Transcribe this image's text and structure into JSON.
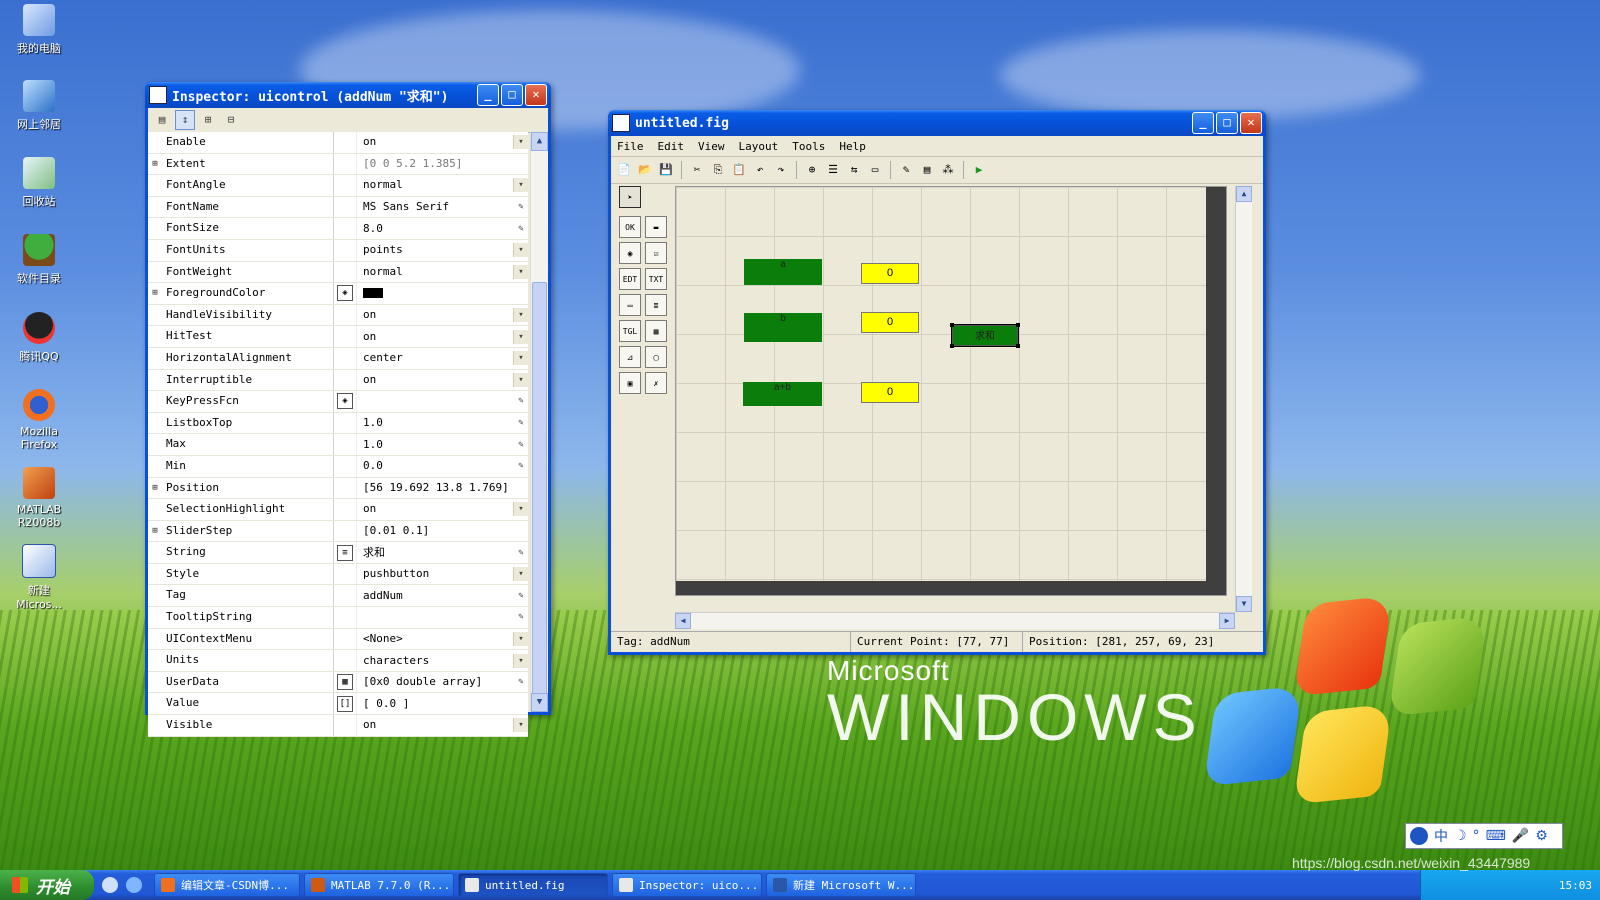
{
  "desktop_icons": [
    {
      "label": "我的电脑",
      "icon": "my-computer-icon"
    },
    {
      "label": "网上邻居",
      "icon": "network-icon"
    },
    {
      "label": "回收站",
      "icon": "recycle-bin-icon"
    },
    {
      "label": "软件目录",
      "icon": "tree-icon"
    },
    {
      "label": "腾讯QQ",
      "icon": "qq-penguin-icon"
    },
    {
      "label": "Mozilla Firefox",
      "icon": "firefox-icon"
    },
    {
      "label": "MATLAB R2008b",
      "icon": "matlab-icon"
    },
    {
      "label": "新建 Micros...",
      "icon": "word-doc-icon"
    }
  ],
  "inspector": {
    "title": "Inspector:  uicontrol (addNum \"求和\")",
    "properties": [
      {
        "name": "Enable",
        "value": "on",
        "expand": "",
        "ctl": "▾",
        "btn": ""
      },
      {
        "name": "Extent",
        "value": "[0 0 5.2 1.385]",
        "expand": "⊞",
        "ctl": "",
        "btn": ""
      },
      {
        "name": "FontAngle",
        "value": "normal",
        "expand": "",
        "ctl": "▾",
        "btn": ""
      },
      {
        "name": "FontName",
        "value": "MS Sans Serif",
        "expand": "",
        "ctl": "✎",
        "btn": ""
      },
      {
        "name": "FontSize",
        "value": "8.0",
        "expand": "",
        "ctl": "✎",
        "btn": ""
      },
      {
        "name": "FontUnits",
        "value": "points",
        "expand": "",
        "ctl": "▾",
        "btn": ""
      },
      {
        "name": "FontWeight",
        "value": "normal",
        "expand": "",
        "ctl": "▾",
        "btn": ""
      },
      {
        "name": "ForegroundColor",
        "value": "",
        "expand": "⊞",
        "ctl": "",
        "btn": "◈"
      },
      {
        "name": "HandleVisibility",
        "value": "on",
        "expand": "",
        "ctl": "▾",
        "btn": ""
      },
      {
        "name": "HitTest",
        "value": "on",
        "expand": "",
        "ctl": "▾",
        "btn": ""
      },
      {
        "name": "HorizontalAlignment",
        "value": "center",
        "expand": "",
        "ctl": "▾",
        "btn": ""
      },
      {
        "name": "Interruptible",
        "value": "on",
        "expand": "",
        "ctl": "▾",
        "btn": ""
      },
      {
        "name": "KeyPressFcn",
        "value": "",
        "expand": "",
        "ctl": "✎",
        "btn": "◈"
      },
      {
        "name": "ListboxTop",
        "value": "1.0",
        "expand": "",
        "ctl": "✎",
        "btn": ""
      },
      {
        "name": "Max",
        "value": "1.0",
        "expand": "",
        "ctl": "✎",
        "btn": ""
      },
      {
        "name": "Min",
        "value": "0.0",
        "expand": "",
        "ctl": "✎",
        "btn": ""
      },
      {
        "name": "Position",
        "value": "[56 19.692 13.8 1.769]",
        "expand": "⊞",
        "ctl": "",
        "btn": ""
      },
      {
        "name": "SelectionHighlight",
        "value": "on",
        "expand": "",
        "ctl": "▾",
        "btn": ""
      },
      {
        "name": "SliderStep",
        "value": "[0.01 0.1]",
        "expand": "⊞",
        "ctl": "",
        "btn": ""
      },
      {
        "name": "String",
        "value": "求和",
        "expand": "",
        "ctl": "✎",
        "btn": "≡"
      },
      {
        "name": "Style",
        "value": "pushbutton",
        "expand": "",
        "ctl": "▾",
        "btn": ""
      },
      {
        "name": "Tag",
        "value": "addNum",
        "expand": "",
        "ctl": "✎",
        "btn": ""
      },
      {
        "name": "TooltipString",
        "value": "",
        "expand": "",
        "ctl": "✎",
        "btn": ""
      },
      {
        "name": "UIContextMenu",
        "value": "<None>",
        "expand": "",
        "ctl": "▾",
        "btn": ""
      },
      {
        "name": "Units",
        "value": "characters",
        "expand": "",
        "ctl": "▾",
        "btn": ""
      },
      {
        "name": "UserData",
        "value": "[0x0  double array]",
        "expand": "",
        "ctl": "✎",
        "btn": "▦"
      },
      {
        "name": "Value",
        "value": "[ 0.0 ]",
        "expand": "",
        "ctl": "",
        "btn": "[]"
      },
      {
        "name": "Visible",
        "value": "on",
        "expand": "",
        "ctl": "▾",
        "btn": ""
      }
    ],
    "foreground_color": "#000000"
  },
  "guide": {
    "title": "untitled.fig",
    "menu": [
      "File",
      "Edit",
      "View",
      "Layout",
      "Tools",
      "Help"
    ],
    "components": {
      "label_a": "a",
      "label_b": "b",
      "label_ab": "a+b",
      "edit1": "0",
      "edit2": "0",
      "edit3": "0",
      "button": "求和"
    },
    "status": {
      "tag": "Tag:  addNum",
      "current_point": "Current Point:  [77, 77]",
      "position": "Position:  [281, 257, 69, 23]"
    }
  },
  "desktop_brand": {
    "line1": "Microsoft",
    "line2": "WINDOWS"
  },
  "taskbar": {
    "start": "开始",
    "tasks": [
      {
        "label": "编辑文章-CSDN博...",
        "active": false
      },
      {
        "label": "MATLAB  7.7.0  (R...",
        "active": false
      },
      {
        "label": "untitled.fig",
        "active": true
      },
      {
        "label": "Inspector:  uico...",
        "active": false
      },
      {
        "label": "新建 Microsoft W...",
        "active": false
      }
    ],
    "clock": "15:03"
  },
  "ime_bar": {
    "text": "中"
  },
  "watermark": "https://blog.csdn.net/weixin_43447989"
}
